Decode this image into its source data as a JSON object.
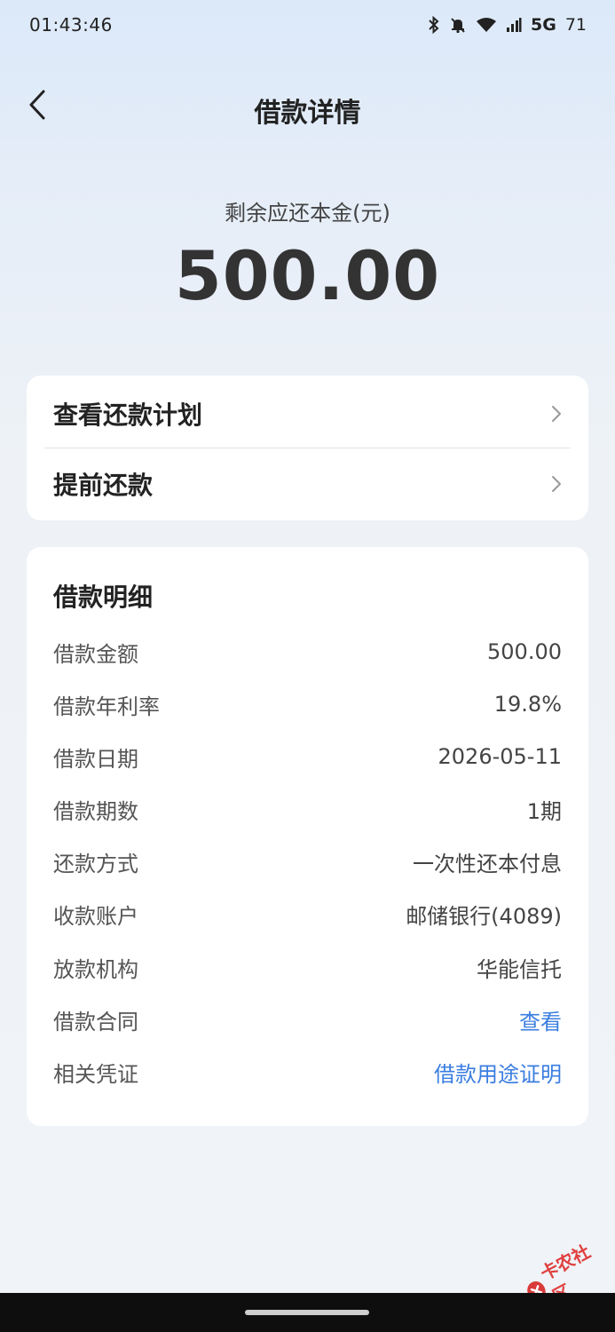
{
  "status_bar": {
    "time": "01:43:46",
    "network": "5G",
    "battery": "71"
  },
  "nav": {
    "title": "借款详情",
    "back_icon": "chevron-left-icon"
  },
  "summary": {
    "label": "剩余应还本金(元)",
    "amount": "500.00"
  },
  "actions": [
    {
      "label": "查看还款计划"
    },
    {
      "label": "提前还款"
    }
  ],
  "details": {
    "title": "借款明细",
    "rows": [
      {
        "key": "借款金额",
        "value": "500.00"
      },
      {
        "key": "借款年利率",
        "value": "19.8%"
      },
      {
        "key": "借款日期",
        "value": "2026-05-11"
      },
      {
        "key": "借款期数",
        "value": "1期"
      },
      {
        "key": "还款方式",
        "value": "一次性还本付息"
      },
      {
        "key": "收款账户",
        "value": "邮储银行(4089)"
      },
      {
        "key": "放款机构",
        "value": "华能信托"
      },
      {
        "key": "借款合同",
        "value": "查看"
      },
      {
        "key": "相关凭证",
        "value": "借款用途证明"
      }
    ]
  },
  "watermark": {
    "text": "卡农社区"
  },
  "colors": {
    "link": "#3b7ee0",
    "card": "#ffffff",
    "title": "#222222"
  }
}
